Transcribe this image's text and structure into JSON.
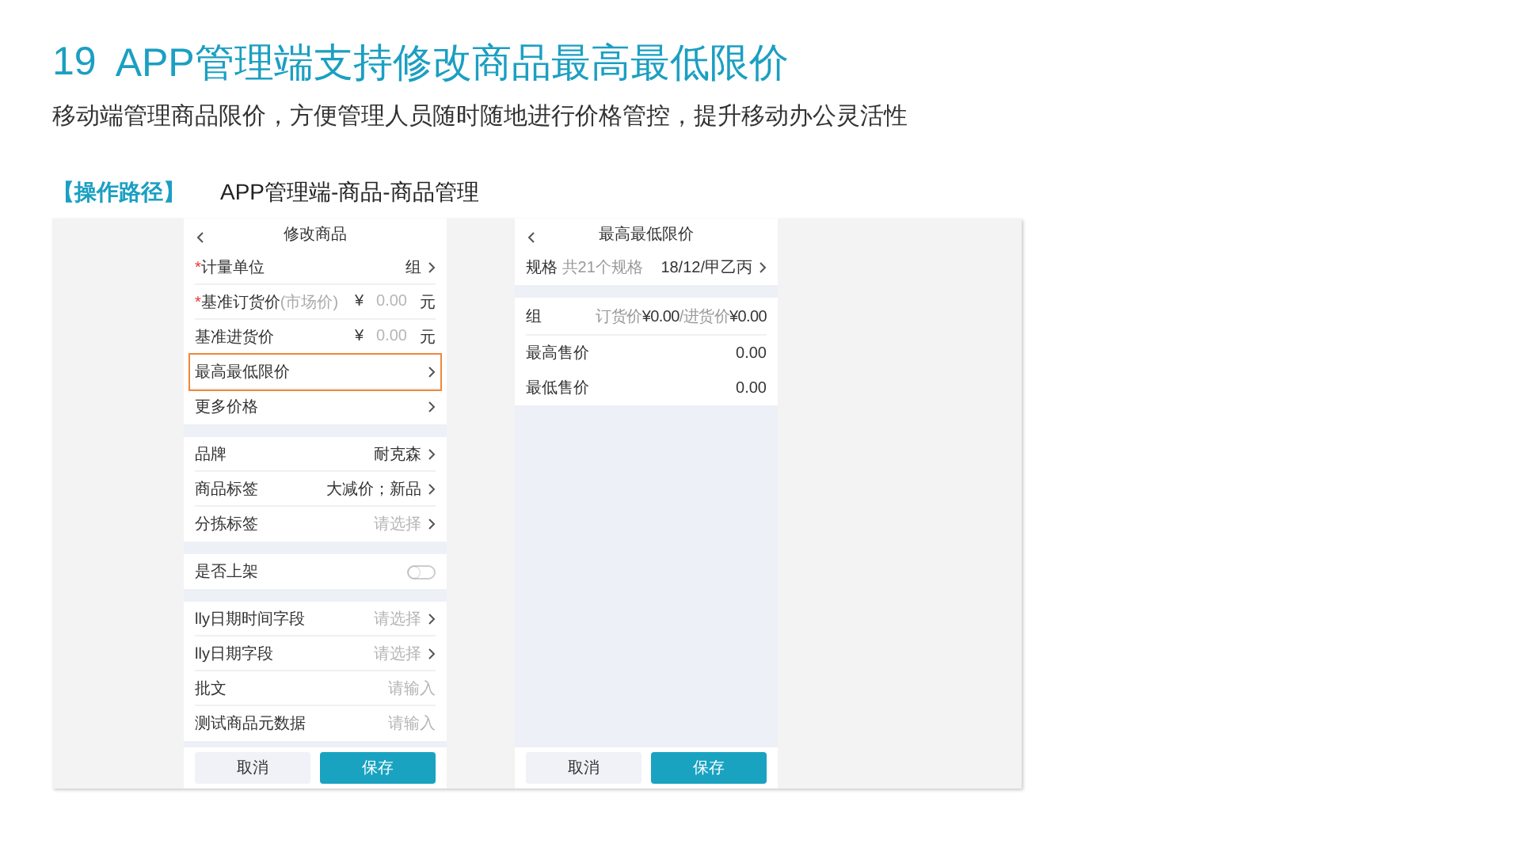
{
  "title": {
    "number": "19",
    "text": "APP管理端支持修改商品最高最低限价"
  },
  "subtitle": "移动端管理商品限价，方便管理人员随时随地进行价格管控，提升移动办公灵活性",
  "path": {
    "label": "【操作路径】",
    "value": "APP管理端-商品-商品管理"
  },
  "edit_screen": {
    "title": "修改商品",
    "sections": [
      [
        {
          "kind": "nav",
          "label": "计量单位",
          "required_mark": "*",
          "highlighted": false,
          "value": "组"
        },
        {
          "kind": "price",
          "label": "基准订货价",
          "required_mark": "*",
          "highlighted": false,
          "hint": "(市场价)",
          "currency": "¥",
          "placeholder": "0.00",
          "unit": "元"
        },
        {
          "kind": "price",
          "label": "基准进货价",
          "highlighted": false,
          "currency": "¥",
          "placeholder": "0.00",
          "unit": "元"
        },
        {
          "kind": "nav",
          "label": "最高最低限价",
          "highlighted": true
        },
        {
          "kind": "nav",
          "label": "更多价格",
          "highlighted": false
        }
      ],
      [
        {
          "kind": "nav",
          "label": "品牌",
          "highlighted": false,
          "value": "耐克森"
        },
        {
          "kind": "nav",
          "label": "商品标签",
          "highlighted": false,
          "value": "大减价；新品"
        },
        {
          "kind": "nav",
          "label": "分拣标签",
          "highlighted": false,
          "placeholder": "请选择"
        }
      ],
      [
        {
          "kind": "toggle",
          "label": "是否上架",
          "highlighted": false,
          "on": false
        }
      ],
      [
        {
          "kind": "nav",
          "label": "lly日期时间字段",
          "highlighted": false,
          "placeholder": "请选择"
        },
        {
          "kind": "nav",
          "label": "lly日期字段",
          "highlighted": false,
          "placeholder": "请选择"
        },
        {
          "kind": "input",
          "label": "批文",
          "highlighted": false,
          "placeholder": "请输入"
        },
        {
          "kind": "input",
          "label": "测试商品元数据",
          "highlighted": false,
          "placeholder": "请输入"
        }
      ]
    ],
    "buttons": [
      {
        "label": "取消",
        "primary": false
      },
      {
        "label": "保存",
        "primary": true
      }
    ]
  },
  "limit_screen": {
    "title": "最高最低限价",
    "spec": {
      "label": "规格",
      "hint": "共21个规格",
      "value": "18/12/甲乙丙"
    },
    "group": {
      "name": "组",
      "order_label": "订货价",
      "order_value": "¥0.00",
      "separator": "/",
      "purchase_label": "进货价",
      "purchase_value": "¥0.00"
    },
    "rows": [
      {
        "label": "最高售价",
        "value": "0.00"
      },
      {
        "label": "最低售价",
        "value": "0.00"
      }
    ],
    "buttons": [
      {
        "label": "取消",
        "primary": false
      },
      {
        "label": "保存",
        "primary": true
      }
    ]
  }
}
